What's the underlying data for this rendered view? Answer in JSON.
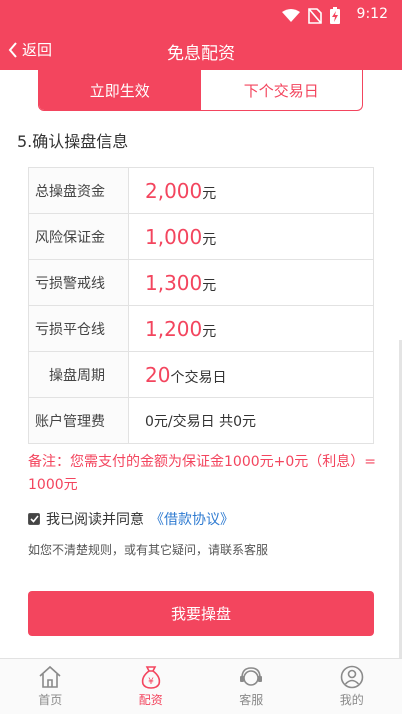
{
  "status_bar": {
    "time": "9:12"
  },
  "header": {
    "back_label": "返回",
    "title": "免息配资"
  },
  "tabs": [
    {
      "label": "立即生效",
      "active": true
    },
    {
      "label": "下个交易日",
      "active": false
    }
  ],
  "section_title": "5.确认操盘信息",
  "info_rows": [
    {
      "label": "总操盘资金",
      "value": "2,000",
      "unit": "元"
    },
    {
      "label": "风险保证金",
      "value": "1,000",
      "unit": "元"
    },
    {
      "label": "亏损警戒线",
      "value": "1,300",
      "unit": "元"
    },
    {
      "label": "亏损平仓线",
      "value": "1,200",
      "unit": "元"
    },
    {
      "label": "操盘周期",
      "value": "20",
      "unit": "个交易日"
    },
    {
      "label": "账户管理费",
      "value_text": "0元/交易日 共0元"
    }
  ],
  "note": "备注：您需支付的金额为保证金1000元+0元（利息）= 1000元",
  "agreement": {
    "text": "我已阅读并同意",
    "link": "《借款协议》",
    "checked": true
  },
  "hint": "如您不清楚规则，或有其它疑问，请联系客服",
  "primary_button": "我要操盘",
  "bottom_nav": [
    {
      "label": "首页",
      "icon": "home-icon",
      "active": false
    },
    {
      "label": "配资",
      "icon": "money-bag-icon",
      "active": true
    },
    {
      "label": "客服",
      "icon": "headset-icon",
      "active": false
    },
    {
      "label": "我的",
      "icon": "user-icon",
      "active": false
    }
  ],
  "colors": {
    "accent": "#f3455e",
    "link": "#2f7bd1"
  }
}
